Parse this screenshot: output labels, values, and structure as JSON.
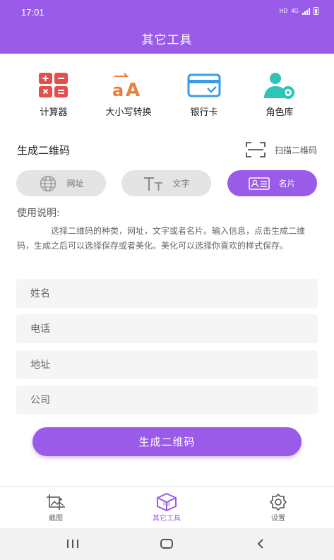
{
  "status": {
    "time": "17:01",
    "net_hd": "HD",
    "net_4g": "4G"
  },
  "header": {
    "title": "其它工具"
  },
  "tools": [
    {
      "label": "计算器",
      "icon": "calculator-icon"
    },
    {
      "label": "大小写转换",
      "icon": "case-convert-icon"
    },
    {
      "label": "银行卡",
      "icon": "bank-card-icon"
    },
    {
      "label": "角色库",
      "icon": "role-library-icon"
    }
  ],
  "qr": {
    "section_title": "生成二维码",
    "scan_label": "扫描二维码",
    "types": [
      {
        "label": "网址",
        "icon": "globe-icon"
      },
      {
        "label": "文字",
        "icon": "text-icon"
      },
      {
        "label": "名片",
        "icon": "business-card-icon"
      }
    ],
    "selected_type": "名片"
  },
  "usage": {
    "title": "使用说明:",
    "text": "选择二维码的种类，网址，文字或者名片。输入信息，点击生成二维码，生成之后可以选择保存或者美化。美化可以选择你喜欢的样式保存。"
  },
  "form": {
    "name_placeholder": "姓名",
    "phone_placeholder": "电话",
    "address_placeholder": "地址",
    "company_placeholder": "公司",
    "submit_label": "生成二维码"
  },
  "tabbar": {
    "items": [
      {
        "label": "截图",
        "icon": "screenshot-icon"
      },
      {
        "label": "其它工具",
        "icon": "toolbox-icon"
      },
      {
        "label": "设置",
        "icon": "settings-gear-icon"
      }
    ],
    "active": "其它工具"
  },
  "colors": {
    "accent": "#9a5ce8",
    "calculator": "#e84d4d",
    "case": "#e8803a",
    "card": "#3a9be8",
    "role": "#2ec4b6"
  }
}
